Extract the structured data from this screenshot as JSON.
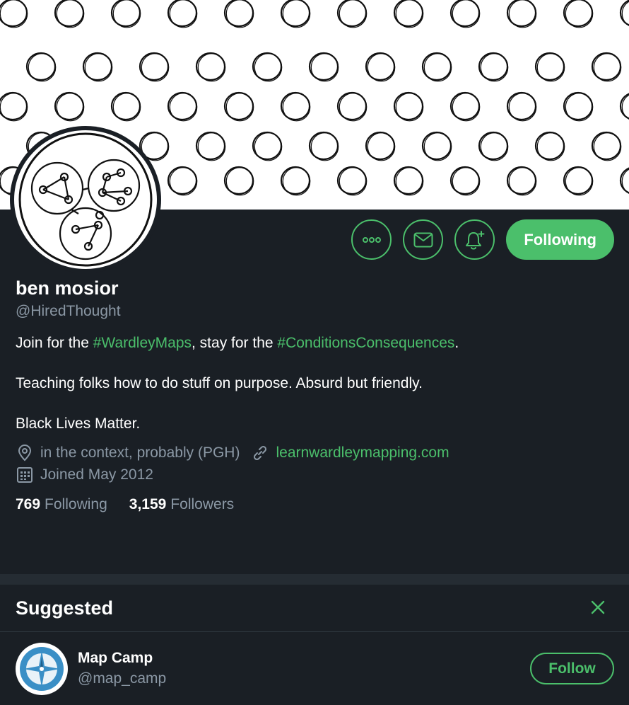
{
  "profile": {
    "name": "ben mosior",
    "handle": "@HiredThought",
    "bio": {
      "line1_pre": "Join for the ",
      "line1_tag1": "#WardleyMaps",
      "line1_mid": ", stay for the ",
      "line1_tag2": "#ConditionsConsequences",
      "line1_post": ".",
      "line2": "Teaching folks how to do stuff on purpose. Absurd but friendly.",
      "line3": "Black Lives Matter."
    },
    "location": "in the context, probably (PGH)",
    "website": "learnwardleymapping.com",
    "joined": "Joined May 2012",
    "following_count": "769",
    "following_label": "Following",
    "followers_count": "3,159",
    "followers_label": "Followers"
  },
  "actions": {
    "more_icon": "more-icon",
    "message_icon": "envelope-icon",
    "notify_icon": "bell-plus-icon",
    "follow_state_label": "Following"
  },
  "suggested": {
    "title": "Suggested",
    "close_icon": "close-icon",
    "items": [
      {
        "name": "Map Camp",
        "handle": "@map_camp",
        "button_label": "Follow",
        "avatar_icon": "compass-icon"
      }
    ]
  },
  "colors": {
    "accent": "#4bbf6b",
    "background": "#1a1f25",
    "secondary_text": "#8b98a5",
    "banner": "#ffffff"
  }
}
